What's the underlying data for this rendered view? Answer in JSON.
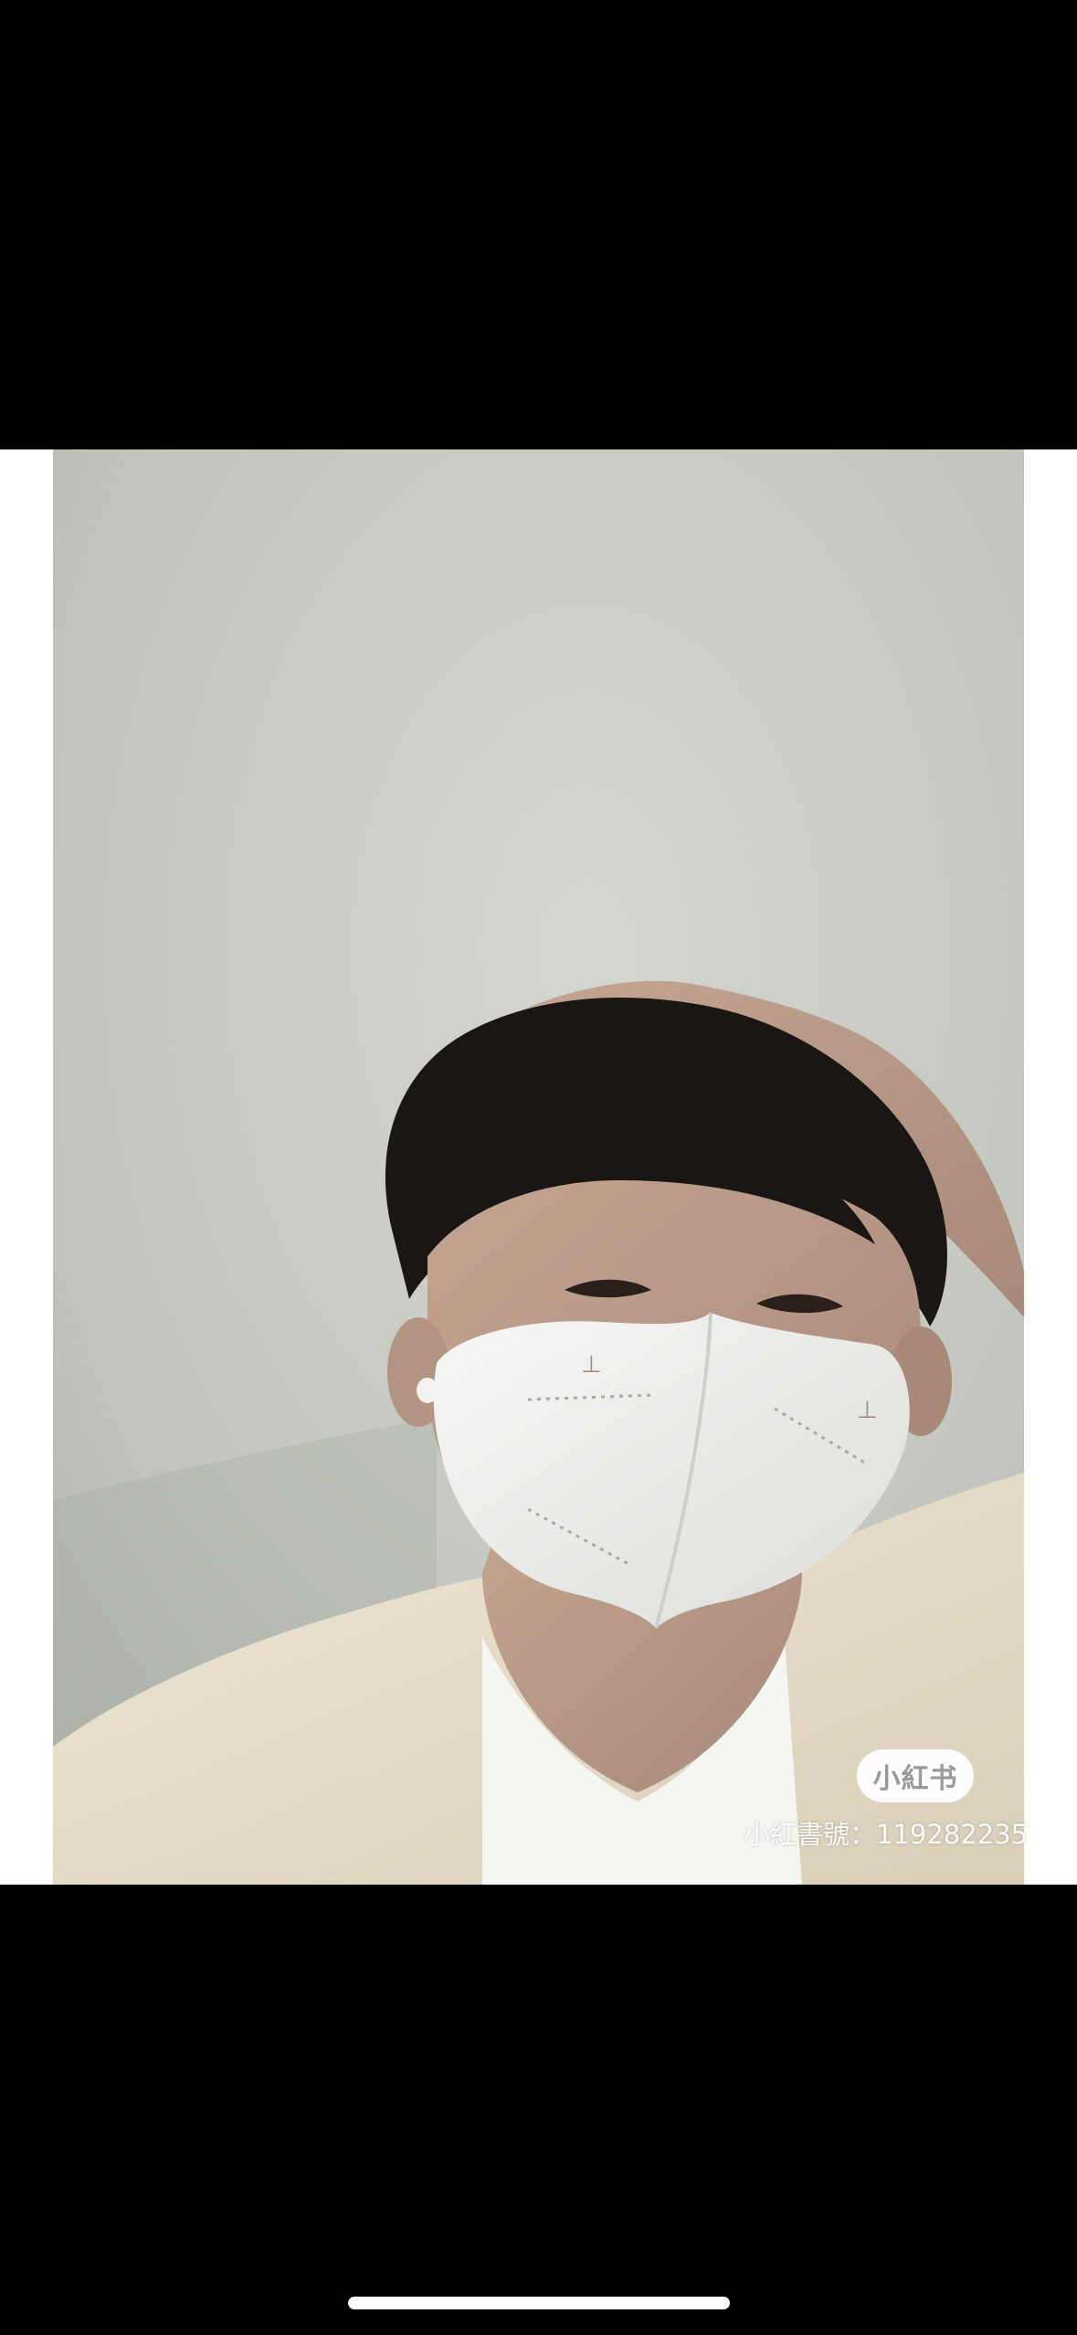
{
  "watermark": {
    "logo_text": "小紅书",
    "id_text": "小紅書號：119282235"
  },
  "photo": {
    "subject": "selfie-person-wearing-face-mask",
    "colors": {
      "wall": "#c8ccc4",
      "hair": "#1a1614",
      "skin": "#b89a86",
      "mask": "#f1f1ee",
      "shirt": "#e9e0cc",
      "tshirt": "#f5f5f2"
    }
  }
}
